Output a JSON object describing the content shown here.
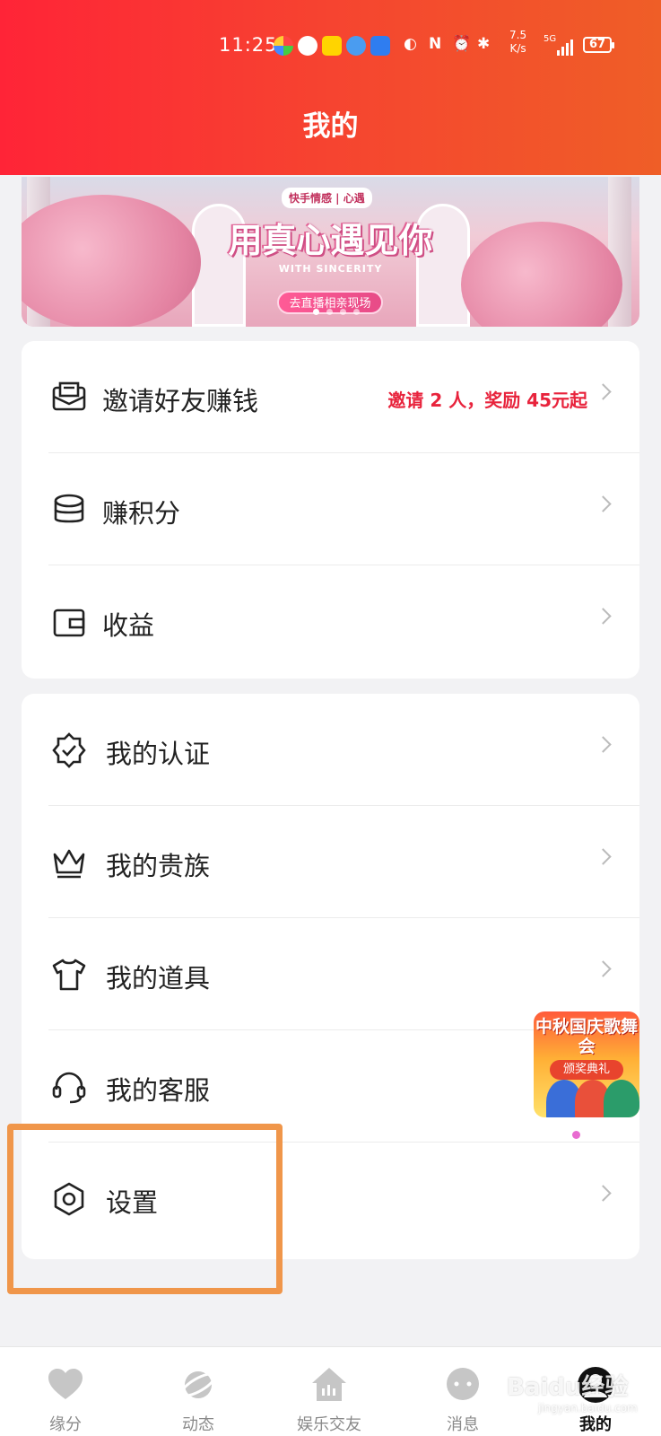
{
  "status_bar": {
    "time": "11:25",
    "speed_value": "7.5",
    "speed_unit": "K/s",
    "network": "5G",
    "battery": "67"
  },
  "header": {
    "title": "我的"
  },
  "banner": {
    "tag": "快手情感 | 心遇",
    "headline": "用真心遇见你",
    "subtitle": "WITH SINCERITY",
    "button": "去直播相亲现场"
  },
  "menu_group_1": [
    {
      "label": "邀请好友赚钱",
      "icon": "envelope-icon",
      "extra": "邀请 2 人，奖励 45元起"
    },
    {
      "label": "赚积分",
      "icon": "coins-icon"
    },
    {
      "label": "收益",
      "icon": "wallet-icon"
    }
  ],
  "menu_group_2": [
    {
      "label": "我的认证",
      "icon": "verified-badge-icon"
    },
    {
      "label": "我的贵族",
      "icon": "crown-icon"
    },
    {
      "label": "我的道具",
      "icon": "tshirt-icon"
    },
    {
      "label": "我的客服",
      "icon": "headset-icon"
    },
    {
      "label": "设置",
      "icon": "settings-hexagon-icon"
    }
  ],
  "floating_ad": {
    "title": "中秋国庆歌舞会",
    "badge": "颁奖典礼"
  },
  "tabbar": [
    {
      "label": "缘分",
      "icon": "heart-icon",
      "active": false
    },
    {
      "label": "动态",
      "icon": "planet-icon",
      "active": false
    },
    {
      "label": "娱乐交友",
      "icon": "home-audio-icon",
      "active": false
    },
    {
      "label": "消息",
      "icon": "chat-bubble-icon",
      "active": false
    },
    {
      "label": "我的",
      "icon": "profile-icon",
      "active": true
    }
  ],
  "colors": {
    "header_start": "#ff2437",
    "header_end": "#ef5e27",
    "accent_red": "#e8233c",
    "highlight_box": "#f0964a"
  },
  "watermark": {
    "logo": "Baidu经验",
    "url": "jingyan.baidu.com"
  }
}
